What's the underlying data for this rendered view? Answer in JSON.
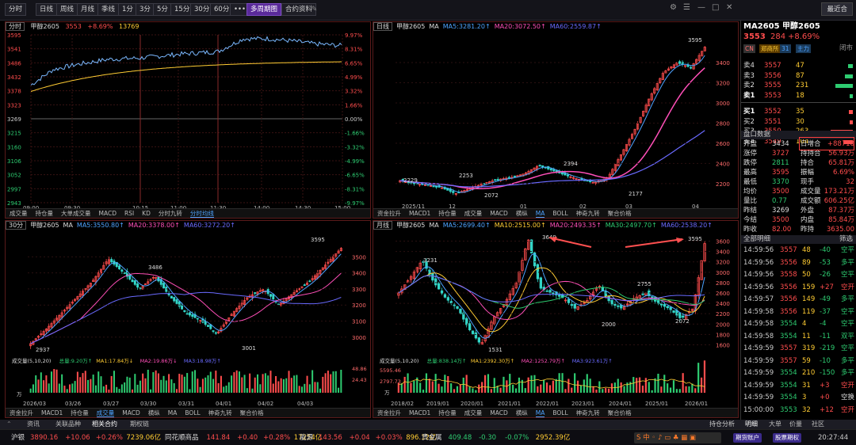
{
  "toolbar": {
    "buttons": [
      "分时",
      "日线",
      "周线",
      "月线",
      "季线",
      "1分",
      "3分",
      "5分",
      "15分",
      "30分",
      "60分",
      "•••",
      "多周期图",
      "合约资料"
    ],
    "back_label": "最近合"
  },
  "quote": {
    "code_name": "MA2605  甲醇2605",
    "price": "3553",
    "change": "284",
    "change_pct": "+8.69%",
    "tags": [
      "CN",
      "郑商所",
      "31",
      "主力"
    ],
    "status": "闭市",
    "asks": [
      {
        "label": "卖4",
        "price": "3557",
        "vol": "47"
      },
      {
        "label": "卖3",
        "price": "3556",
        "vol": "87"
      },
      {
        "label": "卖2",
        "price": "3555",
        "vol": "231"
      },
      {
        "label": "卖1",
        "price": "3553",
        "vol": "18"
      }
    ],
    "bids": [
      {
        "label": "买1",
        "price": "3552",
        "vol": "35"
      },
      {
        "label": "买2",
        "price": "3551",
        "vol": "30"
      },
      {
        "label": "买3",
        "price": "3550",
        "vol": "263"
      },
      {
        "label": "买4",
        "price": "3549",
        "vol": "104"
      }
    ],
    "section_title": "盘口数据",
    "stats": [
      [
        "开盘",
        "3434",
        "日增合",
        "+88718"
      ],
      [
        "涨停",
        "3727",
        "持持合",
        "56.93万"
      ],
      [
        "跌停",
        "2811",
        "持合",
        "65.81万"
      ],
      [
        "最高",
        "3595",
        "振幅",
        "6.69%"
      ],
      [
        "最低",
        "3370",
        "现手",
        "32"
      ],
      [
        "均价",
        "3500",
        "成交量",
        "173.21万"
      ],
      [
        "量比",
        "0.77",
        "成交额",
        "606.25亿"
      ],
      [
        "昨结",
        "3269",
        "外盘",
        "87.37万"
      ],
      [
        "今结",
        "3500",
        "内盘",
        "85.84万"
      ],
      [
        "昨收",
        "82.00",
        "昨持",
        "3635.00"
      ]
    ],
    "ticks_title": "全部明细",
    "ticks_filter": "筛选",
    "ticks": [
      [
        "14:59:56",
        "3557",
        "48",
        "-40",
        "空平"
      ],
      [
        "14:59:56",
        "3556",
        "89",
        "-53",
        "多平"
      ],
      [
        "14:59:56",
        "3558",
        "50",
        "-26",
        "空平"
      ],
      [
        "14:59:56",
        "3556",
        "159",
        "+27",
        "空开"
      ],
      [
        "14:59:57",
        "3556",
        "149",
        "-49",
        "多平"
      ],
      [
        "14:59:58",
        "3556",
        "119",
        "-37",
        "空平"
      ],
      [
        "14:59:58",
        "3554",
        "4",
        "-4",
        "空平"
      ],
      [
        "14:59:58",
        "3554",
        "11",
        "-11",
        "双平"
      ],
      [
        "14:59:59",
        "3557",
        "319",
        "-219",
        "空平"
      ],
      [
        "14:59:59",
        "3557",
        "59",
        "-10",
        "多平"
      ],
      [
        "14:59:59",
        "3554",
        "210",
        "-150",
        "多平"
      ],
      [
        "14:59:59",
        "3554",
        "31",
        "+3",
        "空开"
      ],
      [
        "14:59:59",
        "3554",
        "3",
        "+0",
        "空换"
      ],
      [
        "15:00:00",
        "3553",
        "32",
        "+12",
        "空开"
      ]
    ],
    "bottom_tabs": [
      "明细",
      "大单",
      "价量",
      "社区"
    ]
  },
  "intraday": {
    "period": "分时",
    "name": "甲醇2605",
    "last": "3553",
    "pct": "+8.69%",
    "vol": "13769",
    "yticks_left": [
      "3595",
      "3541",
      "3486",
      "3432",
      "3378",
      "3323",
      "3269",
      "3215",
      "3160",
      "3106",
      "3052",
      "2997",
      "2943"
    ],
    "yticks_right": [
      "9.97%",
      "8.31%",
      "6.65%",
      "4.99%",
      "3.32%",
      "1.66%",
      "0.00%",
      "-1.66%",
      "-3.32%",
      "-4.99%",
      "-6.65%",
      "-8.31%",
      "-9.97%"
    ],
    "xticks": [
      "09:00",
      "09:30",
      "10:15",
      "11:00",
      "11:30",
      "14:00",
      "14:30",
      "15:00"
    ],
    "foot": [
      "成交量",
      "持仓量",
      "大单成交量",
      "MACD",
      "RSI",
      "KD",
      "分时九转",
      "分时均线"
    ]
  },
  "daily": {
    "period": "日线",
    "name": "甲醇2605",
    "ma_labels": [
      "MA",
      "MA5:3281.20↑",
      "MA20:3072.50↑",
      "MA60:2559.87↑"
    ],
    "ma_colors": [
      "#ddd",
      "#4da3ff",
      "#ff4fb8",
      "#6a6aff"
    ],
    "yticks": [
      "3400",
      "3200",
      "3000",
      "2800",
      "2600",
      "2400",
      "2200"
    ],
    "xticks": [
      "2025/11",
      "12",
      "01",
      "02",
      "03",
      "04"
    ],
    "annotations": [
      "3595",
      "2394",
      "2253",
      "2229",
      "2177",
      "2072"
    ],
    "foot": [
      "资金拉升",
      "MACD1",
      "持仓量",
      "成交量",
      "MACD",
      "横纵",
      "MA",
      "BOLL",
      "神奇九转",
      "聚合价格"
    ]
  },
  "min30": {
    "period": "30分",
    "name": "甲醇2605",
    "ma_labels": [
      "MA",
      "MA5:3550.80↑",
      "MA20:3378.00↑",
      "MA60:3272.20↑"
    ],
    "ma_colors": [
      "#ddd",
      "#4da3ff",
      "#ff4fb8",
      "#6a6aff"
    ],
    "yticks": [
      "3500",
      "3400",
      "3300",
      "3200",
      "3100",
      "3000"
    ],
    "xticks": [
      "2026/03",
      "03/26",
      "03/27",
      "03/30",
      "03/31",
      "04/01",
      "04/02",
      "04/03"
    ],
    "annotations": [
      "3595",
      "3486",
      "3001",
      "2937"
    ],
    "vol_labels": [
      "成交量(5,10,20)",
      "总量:9.20万↑",
      "MA1:17.84万↓",
      "MA2:19.86万↓",
      "MA3:18.98万↑"
    ],
    "vol_colors": [
      "#ddd",
      "#2ecc71",
      "#ffcc33",
      "#ff4fb8",
      "#6a6aff"
    ],
    "vol_ticks": [
      "48.86",
      "24.43",
      "万"
    ],
    "foot": [
      "资金拉升",
      "MACD1",
      "持仓量",
      "成交量",
      "MACD",
      "横纵",
      "MA",
      "BOLL",
      "神奇九转",
      "聚合价格"
    ]
  },
  "monthly": {
    "period": "月线",
    "name": "甲醇2605",
    "ma_labels": [
      "MA",
      "MA5:2699.40↑",
      "MA10:2515.00↑",
      "MA20:2493.35↑",
      "MA30:2497.70↑",
      "MA60:2538.20↑"
    ],
    "ma_colors": [
      "#ddd",
      "#4da3ff",
      "#ffcc33",
      "#ff4fb8",
      "#2ecc71",
      "#6a6aff"
    ],
    "yticks": [
      "3600",
      "3400",
      "3200",
      "3000",
      "2800",
      "2600",
      "2400",
      "2200",
      "2000",
      "1800",
      "1600"
    ],
    "xticks": [
      "2018/02",
      "2019/01",
      "2020/01",
      "2021/01",
      "2022/01",
      "2023/01",
      "2024/01",
      "2025/01",
      "2026/01"
    ],
    "annotations": [
      "3595",
      "3649",
      "3231",
      "2755",
      "2000",
      "2072",
      "1531"
    ],
    "vol_labels": [
      "成交量(5,10,20)",
      "总量:838.14万↑",
      "MA1:2392.30万↑",
      "MA2:1252.79万↑",
      "MA3:923.61万↑"
    ],
    "vol_colors": [
      "#ddd",
      "#2ecc71",
      "#ffcc33",
      "#ff4fb8",
      "#6a6aff"
    ],
    "vol_ticks": [
      "5595.46",
      "2797.73",
      "万"
    ],
    "foot": [
      "资金拉升",
      "MACD1",
      "持仓量",
      "成交量",
      "MACD",
      "横纵",
      "MA",
      "BOLL",
      "神奇九转",
      "聚合价格"
    ]
  },
  "bottom_bar": {
    "tabs": [
      "资讯",
      "关联品种",
      "相关合约",
      "期权链"
    ],
    "right": "持仓分析"
  },
  "status_bar": {
    "items": [
      {
        "name": "沪银",
        "value": "3890.16",
        "chg": "+10.06",
        "pct": "+0.26%",
        "amt": "7239.06亿"
      },
      {
        "name": "同花顺商品",
        "value": "141.84",
        "chg": "+0.40",
        "pct": "+0.28%",
        "amt": "17254亿"
      },
      {
        "name": "能源",
        "value": "143.56",
        "chg": "+0.04",
        "pct": "+0.03%",
        "amt": "896.12亿"
      },
      {
        "name": "贵金属",
        "value": "409.48",
        "chg": "-0.30",
        "pct": "-0.07%",
        "amt": "2952.39亿"
      }
    ],
    "buttons": [
      "期货账户",
      "股票期权"
    ],
    "time": "20:27:44"
  },
  "colors": {
    "up": "#ff4d4d",
    "down": "#2ecc71",
    "accent": "#5a2a9a"
  }
}
